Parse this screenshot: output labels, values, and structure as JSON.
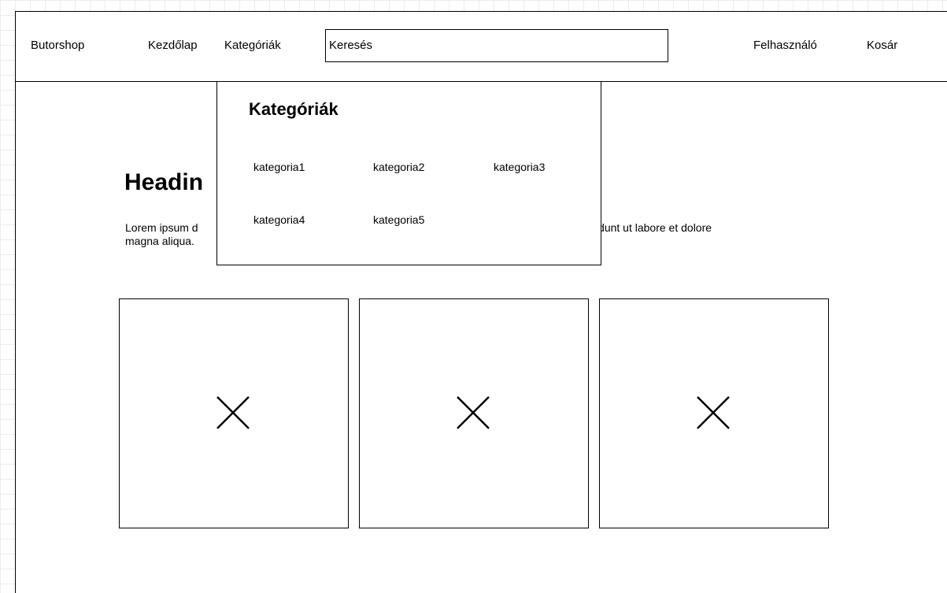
{
  "navbar": {
    "brand": "Butorshop",
    "home": "Kezdőlap",
    "categories": "Kategóriák",
    "search_value": "Keresés",
    "user": "Felhasználó",
    "cart": "Kosár"
  },
  "main": {
    "heading": "Headin",
    "paragraph_left": "Lorem ipsum d",
    "paragraph_right": "r incididunt ut labore et dolore",
    "paragraph_line2": "magna aliqua."
  },
  "dropdown": {
    "title": "Kategóriák",
    "items": [
      "kategoria1",
      "kategoria2",
      "kategoria3",
      "kategoria4",
      "kategoria5"
    ]
  },
  "cards": [
    {
      "icon": "image-placeholder-x-icon"
    },
    {
      "icon": "image-placeholder-x-icon"
    },
    {
      "icon": "image-placeholder-x-icon"
    }
  ]
}
